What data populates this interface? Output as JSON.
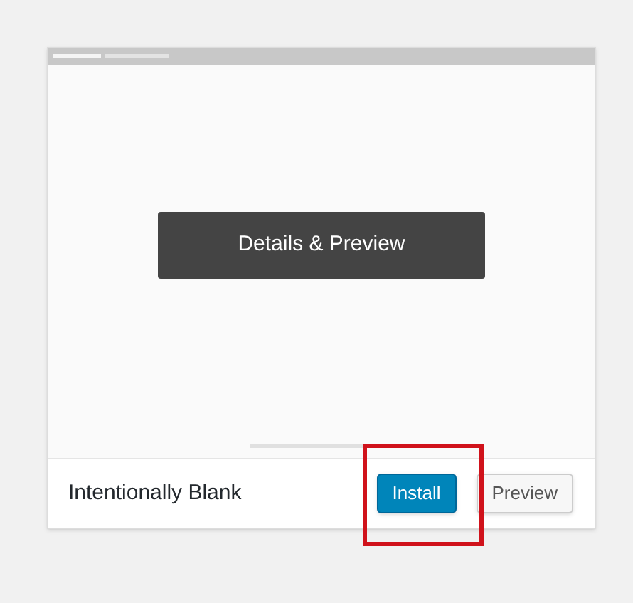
{
  "theme": {
    "name": "Intentionally Blank",
    "overlay_button": "Details & Preview",
    "actions": [
      {
        "label": "Install",
        "kind": "primary"
      },
      {
        "label": "Preview",
        "kind": "secondary"
      }
    ],
    "highlight": true
  }
}
